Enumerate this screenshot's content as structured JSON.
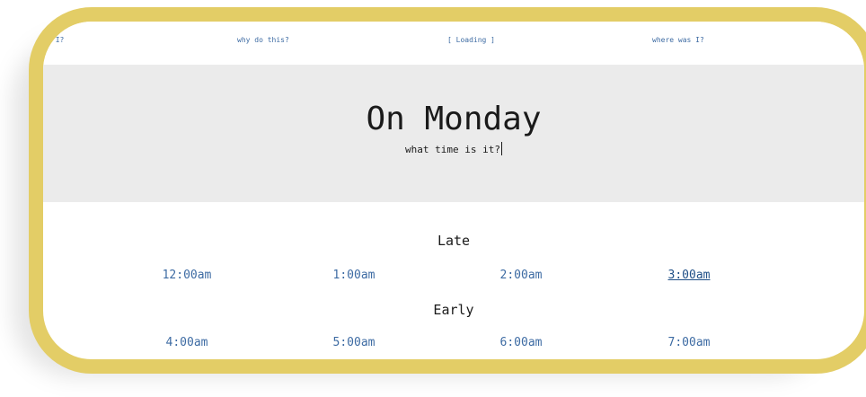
{
  "nav": {
    "items": [
      {
        "label": "who am I?"
      },
      {
        "label": "why do this?"
      },
      {
        "label": "[ Loading ]"
      },
      {
        "label": "where was I?"
      }
    ]
  },
  "hero": {
    "title": "On Monday",
    "subtitle": "what time is it?"
  },
  "sections": [
    {
      "heading": "Late",
      "times": [
        "12:00am",
        "1:00am",
        "2:00am",
        "3:00am"
      ]
    },
    {
      "heading": "Early",
      "times": [
        "4:00am",
        "5:00am",
        "6:00am",
        "7:00am"
      ]
    }
  ],
  "active_time": "3:00am",
  "colors": {
    "frame": "#e3cd66",
    "hero_background": "#ebebeb",
    "link": "#3d6ba3"
  }
}
